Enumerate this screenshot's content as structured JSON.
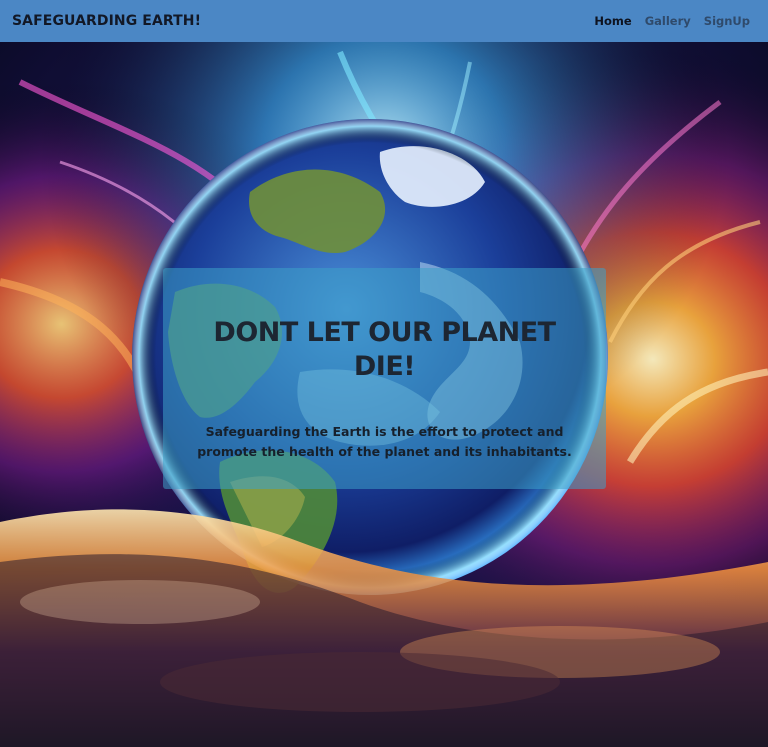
{
  "navbar": {
    "brand": "SAFEGUARDING EARTH!",
    "links": [
      {
        "label": "Home",
        "active": true
      },
      {
        "label": "Gallery",
        "active": false
      },
      {
        "label": "SignUp",
        "active": false
      }
    ]
  },
  "hero": {
    "image_icon": "earth-space-illustration",
    "title": "DONT LET OUR PLANET DIE!",
    "text": "Safeguarding the Earth is the effort to protect and promote the health of the planet and its inhabitants."
  },
  "colors": {
    "navbar": "#4b87c5",
    "card": "rgba(60,160,200,0.55)",
    "title": "#1d2632"
  }
}
